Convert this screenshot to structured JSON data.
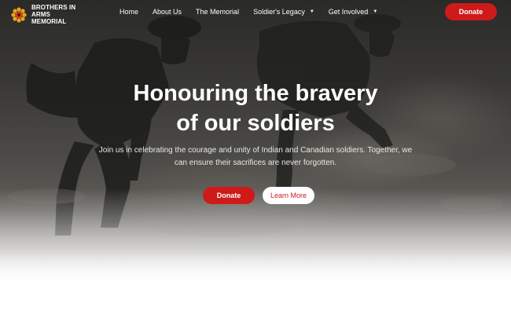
{
  "brand": {
    "line1": "BROTHERS IN ARMS",
    "line2": "MEMORIAL",
    "logo_icon": "poppy-flower-icon",
    "logo_color": "#e8a51b"
  },
  "nav": {
    "items": [
      {
        "label": "Home",
        "has_dropdown": false
      },
      {
        "label": "About Us",
        "has_dropdown": false
      },
      {
        "label": "The Memorial",
        "has_dropdown": false
      },
      {
        "label": "Soldier's Legacy",
        "has_dropdown": true
      },
      {
        "label": "Get Involved",
        "has_dropdown": true
      }
    ],
    "donate_label": "Donate"
  },
  "hero": {
    "title_line1": "Honouring the bravery",
    "title_line2": "of our soldiers",
    "subtitle": "Join us in celebrating the courage and unity of Indian and Canadian soldiers. Together, we can ensure their sacrifices are never forgotten.",
    "primary_cta": "Donate",
    "secondary_cta": "Learn More"
  },
  "colors": {
    "accent": "#cf1a1a",
    "text_light": "#ffffff",
    "logo": "#e8a51b"
  }
}
